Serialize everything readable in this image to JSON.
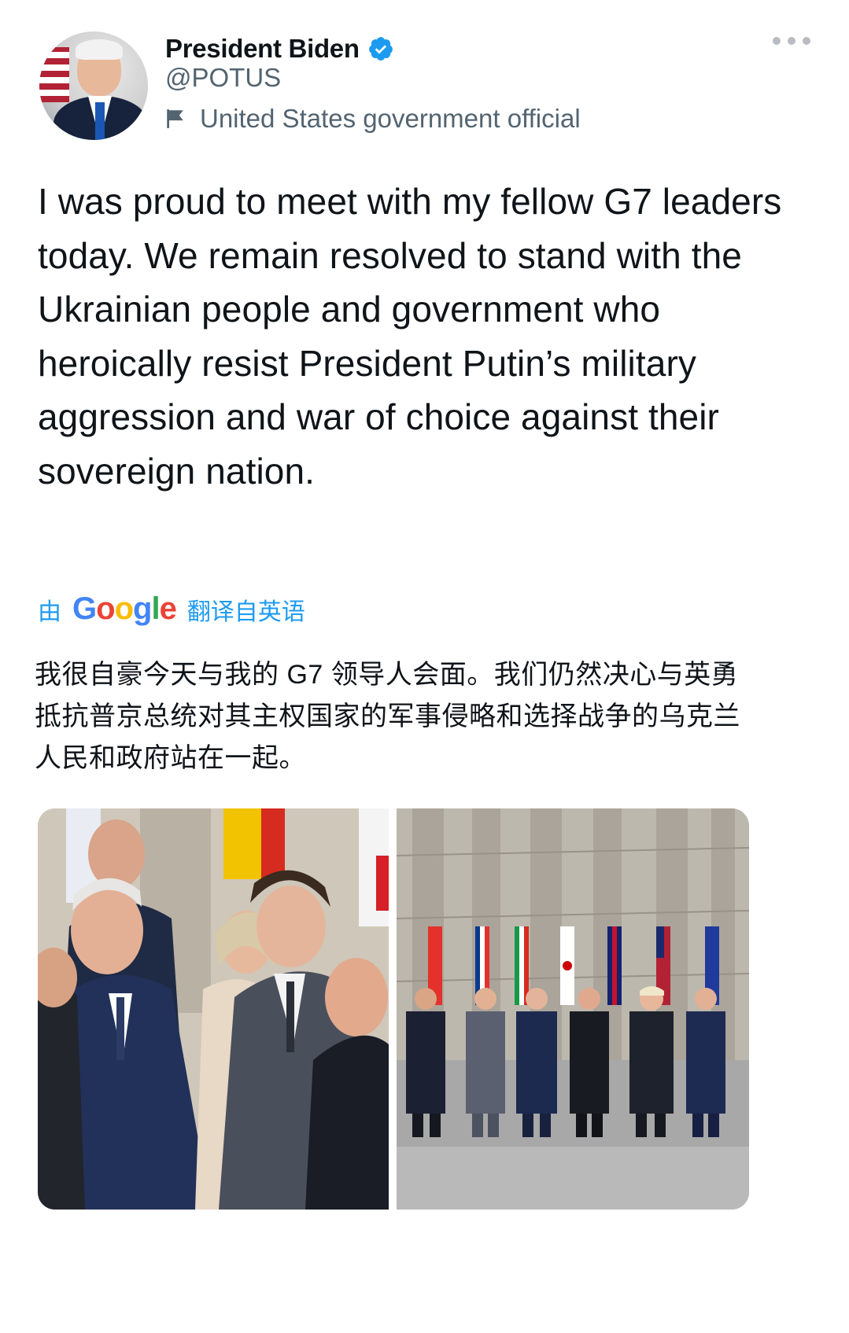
{
  "author": {
    "name": "President Biden",
    "handle": "@POTUS",
    "account_label": "United States government official",
    "verified": true,
    "verified_color": "#1d9bf0"
  },
  "tweet": {
    "text": "I was proud to meet with my fellow G7 leaders today. We remain resolved to stand with the Ukrainian people and government who heroically resist President Putin’s military aggression and war of choice against their sovereign nation."
  },
  "translation": {
    "prefix": "由",
    "provider": "Google",
    "suffix": "翻译自英语",
    "text": "我很自豪今天与我的 G7 领导人会面。我们仍然决心与英勇抵抗普京总统对其主权国家的军事侵略和选择战争的乌克兰人民和政府站在一起。"
  },
  "icons": {
    "more": "more-horizontal-icon",
    "label": "flag-icon",
    "verified": "verified-badge-icon"
  },
  "colors": {
    "accent": "#1d9bf0",
    "muted": "#536471",
    "text": "#0f1419"
  }
}
